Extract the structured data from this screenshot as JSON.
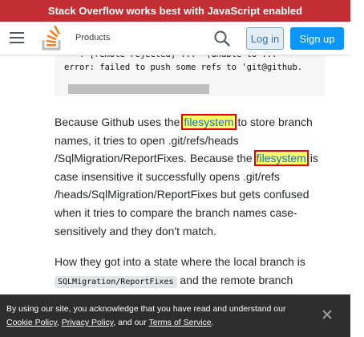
{
  "banner": {
    "text": "Stack Overflow works best with JavaScript enabled"
  },
  "header": {
    "menu_icon": "hamburger-menu-icon",
    "logo": "stack-overflow-logo",
    "products_label": "Products",
    "search_icon": "search-icon",
    "login_label": "Log in",
    "signup_label": "Sign up",
    "accent_color": "#0a95ff",
    "banner_color": "#c22e32"
  },
  "code": {
    "line1": "   ! [remote rejected] ...  (unable to ...",
    "line2": "error: failed to push some refs to 'git@github."
  },
  "answer": {
    "p1_a": "Because Github uses the ",
    "p1_hl1": "filesystem",
    "p1_b": " to store branch names, it tries to open .git/refs/heads /SqlMigration/ReportFixes. Because the ",
    "p1_hl2": "filesystem",
    "p1_c": " is case insensitive it successfully opens .git/refs /heads/SqlMigration/ReportFixes but gets confused when it tries to compare the branch names case-sensitively and they don't match.",
    "p2_a": "How they got into a state where the local branch is ",
    "p2_code": "SQLMigration/ReportFixes",
    "p2_b": " and the remote branch"
  },
  "cookie": {
    "text": "By using our site, you acknowledge that you have read and understand our",
    "cookie_policy": "Cookie Policy",
    "sep1": ", ",
    "privacy_policy": "Privacy Policy",
    "sep2": ", and our ",
    "terms": "Terms of Service",
    "end": ".",
    "close_icon": "close-icon"
  }
}
